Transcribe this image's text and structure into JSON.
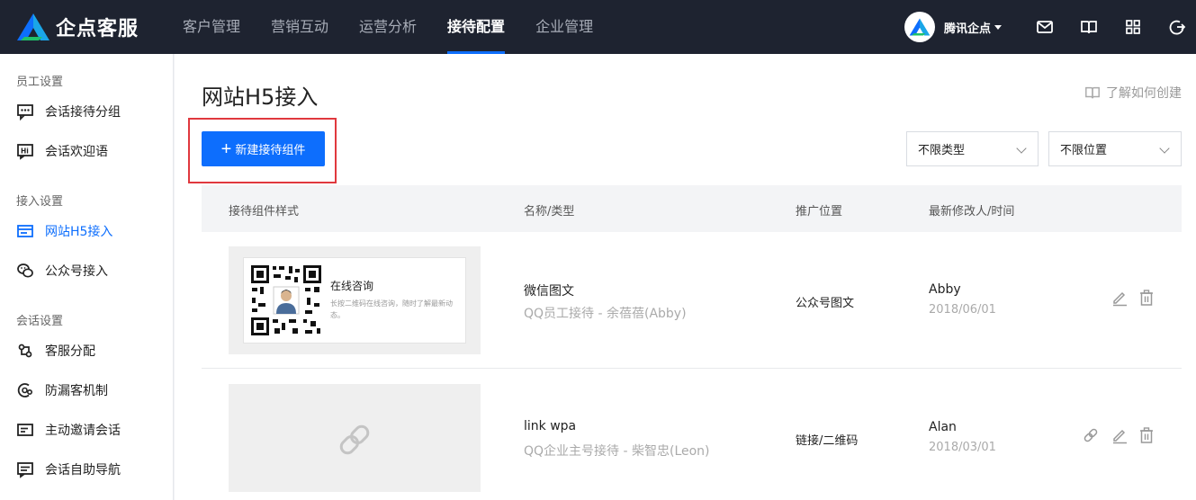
{
  "app": {
    "logo_text": "企点客服"
  },
  "nav": {
    "items": [
      "客户管理",
      "营销互动",
      "运营分析",
      "接待配置",
      "企业管理"
    ],
    "active_index": 3
  },
  "user": {
    "name": "腾讯企点"
  },
  "sidebar": {
    "sections": [
      {
        "title": "员工设置",
        "items": [
          "会话接待分组",
          "会话欢迎语"
        ]
      },
      {
        "title": "接入设置",
        "items": [
          "网站H5接入",
          "公众号接入"
        ]
      },
      {
        "title": "会话设置",
        "items": [
          "客服分配",
          "防漏客机制",
          "主动邀请会话",
          "会话自助导航"
        ]
      }
    ],
    "active_item": "网站H5接入"
  },
  "page": {
    "title": "网站H5接入",
    "help_link": "了解如何创建",
    "new_button": "新建接待组件",
    "filter_type": "不限类型",
    "filter_position": "不限位置"
  },
  "table": {
    "columns": [
      "接待组件样式",
      "名称/类型",
      "推广位置",
      "最新修改人/时间"
    ],
    "rows": [
      {
        "preview_title": "在线咨询",
        "preview_desc": "长按二维码在线咨询，随时了解最新动态。",
        "name": "微信图文",
        "sub": "QQ员工接待 - 余蓓蓓(Abby)",
        "position": "公众号图文",
        "modifier": "Abby",
        "time": "2018/06/01"
      },
      {
        "name": "link wpa",
        "sub": "QQ企业主号接待 - 柴智忠(Leon)",
        "position": "链接/二维码",
        "modifier": "Alan",
        "time": "2018/03/01"
      }
    ]
  },
  "colors": {
    "primary": "#0d6efd",
    "topbar": "#1e2330",
    "highlight": "#e0383e"
  }
}
